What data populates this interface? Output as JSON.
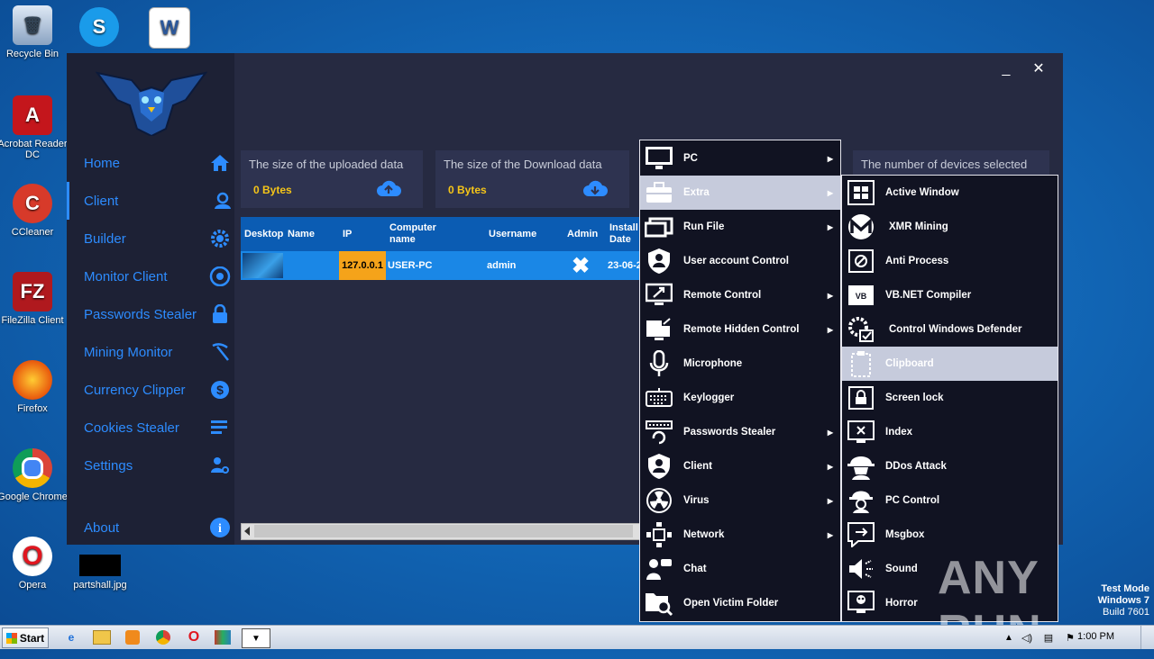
{
  "desktop": {
    "icons": [
      {
        "label": "Recycle Bin"
      },
      {
        "label": "Acrobat Reader DC"
      },
      {
        "label": "CCleaner"
      },
      {
        "label": "FileZilla Client"
      },
      {
        "label": "Firefox"
      },
      {
        "label": "Google Chrome"
      },
      {
        "label": "Opera"
      },
      {
        "label": "partshall.jpg"
      }
    ]
  },
  "app": {
    "window_controls": {
      "minimize": "_",
      "close": "✕"
    },
    "nav": [
      {
        "label": "Home",
        "icon": "home-icon"
      },
      {
        "label": "Client",
        "icon": "user-icon"
      },
      {
        "label": "Builder",
        "icon": "gear-icon"
      },
      {
        "label": "Monitor Client",
        "icon": "eye-icon"
      },
      {
        "label": "Passwords Stealer",
        "icon": "lock-icon"
      },
      {
        "label": "Mining Monitor",
        "icon": "pickaxe-icon"
      },
      {
        "label": "Currency Clipper",
        "icon": "dollar-icon"
      },
      {
        "label": "Cookies Stealer",
        "icon": "list-icon"
      },
      {
        "label": "Settings",
        "icon": "user-gear-icon"
      },
      {
        "label": "About",
        "icon": "info-icon"
      }
    ],
    "stats": [
      {
        "title": "The size of the uploaded data",
        "value": "0 Bytes",
        "icon": "cloud-upload-icon"
      },
      {
        "title": "The size of the Download data",
        "value": "0 Bytes",
        "icon": "cloud-download-icon"
      },
      {
        "title": "The number of devices selected",
        "value": ""
      }
    ],
    "table": {
      "headers": [
        "Desktop",
        "Name",
        "IP",
        "Computer name",
        "Username",
        "Admin",
        "Install Date"
      ],
      "rows": [
        {
          "name": "",
          "ip": "127.0.0.1",
          "computer": "USER-PC",
          "username": "admin",
          "admin": "✖",
          "install": "23-06-2"
        }
      ]
    }
  },
  "context_menu": {
    "items": [
      {
        "label": "PC",
        "submenu": true,
        "icon": "monitor-icon"
      },
      {
        "label": "Extra",
        "submenu": true,
        "icon": "toolbox-icon",
        "highlighted": true
      },
      {
        "label": "Run File",
        "submenu": true,
        "icon": "run-file-icon"
      },
      {
        "label": "User account Control",
        "submenu": false,
        "icon": "shield-user-icon"
      },
      {
        "label": "Remote Control",
        "submenu": true,
        "icon": "remote-control-icon"
      },
      {
        "label": "Remote Hidden Control",
        "submenu": true,
        "icon": "hidden-remote-icon"
      },
      {
        "label": "Microphone",
        "submenu": false,
        "icon": "microphone-icon"
      },
      {
        "label": "Keylogger",
        "submenu": false,
        "icon": "keyboard-icon"
      },
      {
        "label": "Passwords Stealer",
        "submenu": true,
        "icon": "password-icon"
      },
      {
        "label": "Client",
        "submenu": true,
        "icon": "client-shield-icon"
      },
      {
        "label": "Virus",
        "submenu": true,
        "icon": "radiation-icon"
      },
      {
        "label": "Network",
        "submenu": true,
        "icon": "network-icon"
      },
      {
        "label": "Chat",
        "submenu": false,
        "icon": "chat-icon"
      },
      {
        "label": "Open Victim Folder",
        "submenu": false,
        "icon": "folder-search-icon"
      }
    ]
  },
  "submenu": {
    "items": [
      {
        "label": "Active Window",
        "icon": "windows-icon"
      },
      {
        "label": "XMR Mining",
        "icon": "monero-icon"
      },
      {
        "label": "Anti Process",
        "icon": "anti-process-icon"
      },
      {
        "label": "VB.NET Compiler",
        "icon": "vb-icon"
      },
      {
        "label": "Control Windows Defender",
        "icon": "defender-gear-icon"
      },
      {
        "label": "Clipboard",
        "icon": "clipboard-icon",
        "highlighted": true
      },
      {
        "label": "Screen lock",
        "icon": "screen-lock-icon"
      },
      {
        "label": "Index",
        "icon": "index-icon"
      },
      {
        "label": "DDos Attack",
        "icon": "hacker-icon"
      },
      {
        "label": "PC Control",
        "icon": "pc-control-icon"
      },
      {
        "label": "Msgbox",
        "icon": "msgbox-icon"
      },
      {
        "label": "Sound",
        "icon": "speaker-icon"
      },
      {
        "label": "Horror",
        "icon": "horror-icon"
      }
    ]
  },
  "taskbar": {
    "start_label": "Start",
    "clock": "1:00 PM"
  },
  "watermark": {
    "line1": "Test Mode",
    "line2": "Windows 7",
    "line3": "Build 7601",
    "brand": "ANY RUN"
  }
}
